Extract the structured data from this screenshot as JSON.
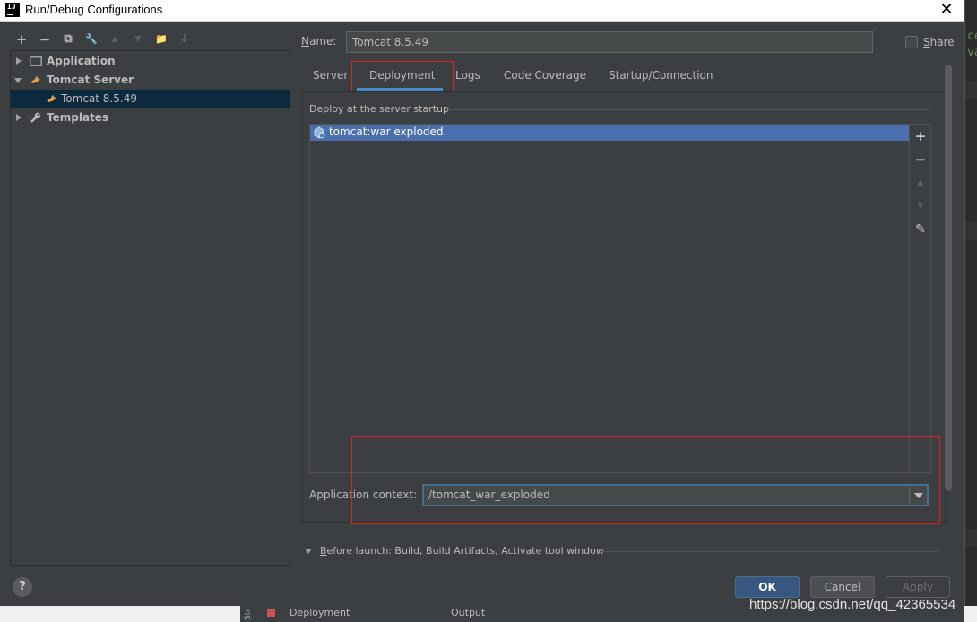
{
  "window": {
    "title": "Run/Debug Configurations",
    "app_icon_text": "IJ",
    "close_glyph": "✕"
  },
  "toolbar": {
    "add": "+",
    "remove": "−",
    "copy": "⧉",
    "edit": "🔧",
    "up": "▲",
    "down": "▼",
    "folder": "📁",
    "sort": "↓"
  },
  "tree": {
    "items": [
      {
        "label": "Application",
        "bold": true,
        "expanded": false,
        "icon": "application-icon"
      },
      {
        "label": "Tomcat Server",
        "bold": true,
        "expanded": true,
        "icon": "tomcat-icon"
      },
      {
        "label": "Tomcat 8.5.49",
        "bold": false,
        "selected": true,
        "icon": "tomcat-icon"
      },
      {
        "label": "Templates",
        "bold": true,
        "expanded": false,
        "icon": "wrench-icon"
      }
    ]
  },
  "name": {
    "label_mnemonic": "N",
    "label_rest": "ame:",
    "value": "Tomcat 8.5.49"
  },
  "share": {
    "label_mnemonic": "S",
    "label_rest": "hare",
    "checked": false
  },
  "tabs": [
    {
      "label": "Server"
    },
    {
      "label": "Deployment",
      "active": true
    },
    {
      "label": "Logs"
    },
    {
      "label": "Code Coverage"
    },
    {
      "label": "Startup/Connection"
    }
  ],
  "deployment": {
    "section_title": "Deploy at the server startup",
    "artifacts": [
      "tomcat:war exploded"
    ],
    "side_buttons": {
      "add": "+",
      "remove": "−",
      "up": "▲",
      "down": "▼",
      "edit": "✎"
    },
    "context_label": "Application context:",
    "context_value": "/tomcat_war_exploded"
  },
  "before_launch": {
    "mnemonic": "B",
    "rest": "efore launch: Build, Build Artifacts, Activate tool window"
  },
  "buttons": {
    "ok": "OK",
    "cancel": "Cancel",
    "apply": "Apply",
    "help": "?"
  },
  "background": {
    "code_lines": [
      "ce",
      "va"
    ],
    "taskbar_str": "Str",
    "taskbar_deployment": "Deployment",
    "taskbar_output": "Output"
  },
  "watermark": "https://blog.csdn.net/qq_42365534",
  "colors": {
    "panel": "#3c3f41",
    "selection": "#4b6eaf",
    "tab_underline": "#4a88c7",
    "highlight_box": "#e02020",
    "ok_button": "#365880"
  }
}
